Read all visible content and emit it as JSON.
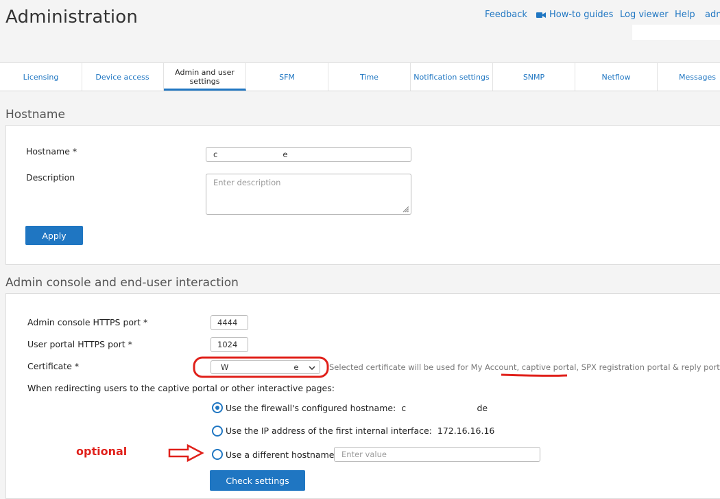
{
  "header": {
    "title": "Administration",
    "links": [
      {
        "label": "Feedback"
      },
      {
        "label": "How-to guides",
        "icon": "video-camera-icon"
      },
      {
        "label": "Log viewer"
      },
      {
        "label": "Help"
      },
      {
        "label": "adm"
      }
    ]
  },
  "tabs": [
    {
      "label": "Licensing"
    },
    {
      "label": "Device access"
    },
    {
      "label": "Admin and user settings",
      "active": true
    },
    {
      "label": "SFM"
    },
    {
      "label": "Time"
    },
    {
      "label": "Notification settings"
    },
    {
      "label": "SNMP"
    },
    {
      "label": "Netflow"
    },
    {
      "label": "Messages"
    }
  ],
  "hostname_section": {
    "title": "Hostname",
    "hostname_label": "Hostname *",
    "hostname_value": "c                          e",
    "description_label": "Description",
    "description_placeholder": "Enter description",
    "apply_label": "Apply"
  },
  "admin_section": {
    "title": "Admin console and end-user interaction",
    "admin_port_label": "Admin console HTTPS port *",
    "admin_port_value": "4444",
    "user_port_label": "User portal HTTPS port *",
    "user_port_value": "1024",
    "certificate_label": "Certificate *",
    "certificate_value": "W                          e",
    "certificate_hint": "Selected certificate will be used for My Account, captive portal, SPX registration portal & reply portal]",
    "redirect_label": "When redirecting users to the captive portal or other interactive pages:",
    "options": [
      {
        "label": "Use the firewall's configured hostname:",
        "value": "c                          de",
        "checked": true
      },
      {
        "label": "Use the IP address of the first internal interface:",
        "value": "172.16.16.16",
        "checked": false
      },
      {
        "label": "Use a different hostname:",
        "placeholder": "Enter value",
        "checked": false
      }
    ],
    "check_button": "Check settings"
  },
  "annotations": {
    "optional_text": "optional",
    "color": "#e0201a"
  },
  "colors": {
    "accent": "#1f76c2",
    "background": "#f4f4f4"
  }
}
